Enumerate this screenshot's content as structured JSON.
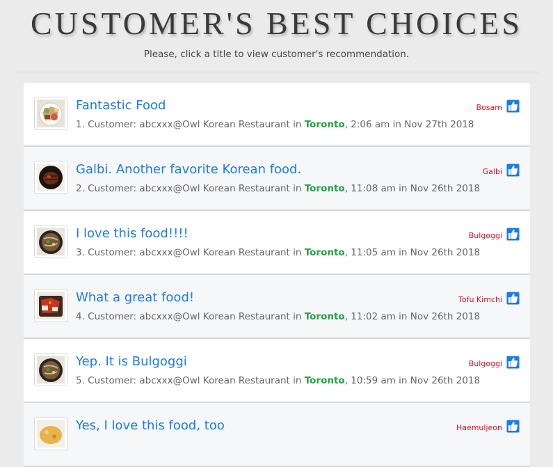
{
  "header": {
    "title": "CUSTOMER'S BEST CHOICES",
    "subtitle": "Please, click a title to view customer's recommendation."
  },
  "colors": {
    "title_link": "#1a7de0",
    "city": "#27a048",
    "tag": "#d0132a",
    "like_icon": "#1a7de0"
  },
  "reviews": [
    {
      "title": "Fantastic Food",
      "meta_prefix": "1. Customer: abcxxx@Owl Korean Restaurant in ",
      "city": "Toronto",
      "meta_suffix": ", 2:06 am in Nov 27th 2018",
      "tag": "Bosam",
      "thumb_icon": "food-plate-photo"
    },
    {
      "title": "Galbi. Another favorite Korean food.",
      "meta_prefix": "2. Customer: abcxxx@Owl Korean Restaurant in ",
      "city": "Toronto",
      "meta_suffix": ", 11:08 am in Nov 26th 2018",
      "tag": "Galbi",
      "thumb_icon": "grilled-meat-photo"
    },
    {
      "title": "I love this food!!!!",
      "meta_prefix": "3. Customer: abcxxx@Owl Korean Restaurant in ",
      "city": "Toronto",
      "meta_suffix": ", 11:05 am in Nov 26th 2018",
      "tag": "Bulgoggi",
      "thumb_icon": "bulgogi-bowl-photo"
    },
    {
      "title": "What a great food!",
      "meta_prefix": "4. Customer: abcxxx@Owl Korean Restaurant in ",
      "city": "Toronto",
      "meta_suffix": ", 11:02 am in Nov 26th 2018",
      "tag": "Tofu Kimchi",
      "thumb_icon": "tofu-kimchi-photo"
    },
    {
      "title": "Yep. It is Bulgoggi",
      "meta_prefix": "5. Customer: abcxxx@Owl Korean Restaurant in ",
      "city": "Toronto",
      "meta_suffix": ", 10:59 am in Nov 26th 2018",
      "tag": "Bulgoggi",
      "thumb_icon": "bulgogi-bowl-photo"
    },
    {
      "title": "Yes, I love this food, too",
      "meta_prefix": "",
      "city": "",
      "meta_suffix": "",
      "tag": "Haemuljeon",
      "thumb_icon": "pancake-photo"
    }
  ]
}
